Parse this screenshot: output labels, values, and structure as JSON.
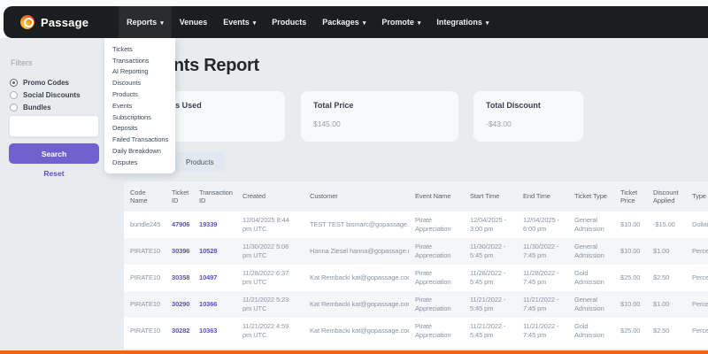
{
  "nav": {
    "brand": "Passage",
    "items": [
      {
        "label": "Reports",
        "caret": true,
        "active": true
      },
      {
        "label": "Venues",
        "caret": false,
        "active": false
      },
      {
        "label": "Events",
        "caret": true,
        "active": false
      },
      {
        "label": "Products",
        "caret": false,
        "active": false
      },
      {
        "label": "Packages",
        "caret": true,
        "active": false
      },
      {
        "label": "Promote",
        "caret": true,
        "active": false
      },
      {
        "label": "Integrations",
        "caret": true,
        "active": false
      }
    ]
  },
  "reports_dropdown": [
    "Tickets",
    "Transactions",
    "AI Reporting",
    "Discounts",
    "Products",
    "Events",
    "Subscriptions",
    "Deposits",
    "Failed Transactions",
    "Daily Breakdown",
    "Disputes"
  ],
  "filters": {
    "title": "Filters",
    "options": [
      {
        "label": "Promo Codes",
        "selected": true
      },
      {
        "label": "Social Discounts",
        "selected": false
      },
      {
        "label": "Bundles",
        "selected": false
      }
    ],
    "search_value": "",
    "search_placeholder": "",
    "search_button": "Search",
    "reset_link": "Reset"
  },
  "page": {
    "title": "Discounts Report",
    "cards": [
      {
        "label": "Total Times Used",
        "value": ""
      },
      {
        "label": "Total Price",
        "value": "$145.00"
      },
      {
        "label": "Total Discount",
        "value": "-$43.00"
      }
    ],
    "tabs": [
      {
        "label": "Products"
      }
    ]
  },
  "table": {
    "columns": [
      "Code Name",
      "Ticket ID",
      "Transaction ID",
      "Created",
      "Customer",
      "Event Name",
      "Start Time",
      "End Time",
      "Ticket Type",
      "Ticket Price",
      "Discount Applied",
      "Type"
    ],
    "rows": [
      {
        "code": "bundle245",
        "ticket_id": "47906",
        "transaction_id": "19339",
        "created": "12/04/2025 8:44 pm UTC",
        "customer": "TEST TEST bismarc@gopassage.com",
        "event": "Pirate Appreciation",
        "start": "12/04/2025 - 3:00 pm",
        "end": "12/04/2025 - 6:00 pm",
        "ticket_type": "General Admission",
        "price": "$10.00",
        "discount": "-$15.00",
        "type": "Dollar"
      },
      {
        "code": "PIRATE10",
        "ticket_id": "30396",
        "transaction_id": "10528",
        "created": "11/30/2022 5:06 pm UTC",
        "customer": "Hanna Ziesel hanna@gopassage.com",
        "event": "Pirate Appreciation",
        "start": "11/30/2022 - 5:45 pm",
        "end": "11/30/2022 - 7:45 pm",
        "ticket_type": "General Admission",
        "price": "$10.00",
        "discount": "$1.00",
        "type": "Percentage"
      },
      {
        "code": "PIRATE10",
        "ticket_id": "30358",
        "transaction_id": "10497",
        "created": "11/28/2022 6:37 pm UTC",
        "customer": "Kat Rembacki kat@gopassage.com",
        "event": "Pirate Appreciation",
        "start": "11/28/2022 - 5:45 pm",
        "end": "11/28/2022 - 7:45 pm",
        "ticket_type": "Gold Admission",
        "price": "$25.00",
        "discount": "$2.50",
        "type": "Percentage"
      },
      {
        "code": "PIRATE10",
        "ticket_id": "30290",
        "transaction_id": "10366",
        "created": "11/21/2022 5:23 pm UTC",
        "customer": "Kat Rembacki kat@gopassage.com",
        "event": "Pirate Appreciation",
        "start": "11/21/2022 - 5:45 pm",
        "end": "11/21/2022 - 7:45 pm",
        "ticket_type": "General Admission",
        "price": "$10.00",
        "discount": "$1.00",
        "type": "Percentage"
      },
      {
        "code": "PIRATE10",
        "ticket_id": "30282",
        "transaction_id": "10363",
        "created": "11/21/2022 4:59 pm UTC",
        "customer": "Kat Rembacki kat@gopassage.com",
        "event": "Pirate Appreciation",
        "start": "11/21/2022 - 5:45 pm",
        "end": "11/21/2022 - 7:45 pm",
        "ticket_type": "Gold Admission",
        "price": "$25.00",
        "discount": "$2.50",
        "type": "Percentage"
      }
    ]
  },
  "colors": {
    "nav_background": "#1b1d1f",
    "page_background": "#e9ecef",
    "accent_purple": "#6f62cf",
    "link_purple": "#5b50c5",
    "brand_orange": "#f2581f",
    "bottom_bar_orange": "#e8671c"
  }
}
